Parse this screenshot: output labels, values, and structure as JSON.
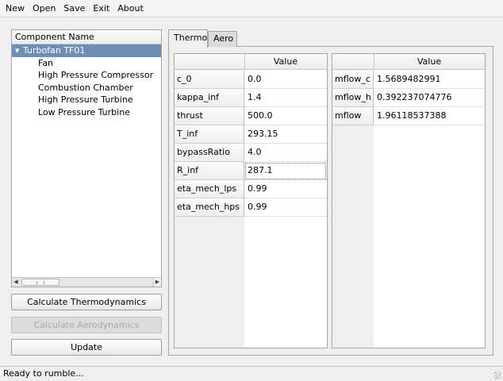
{
  "menu": [
    "New",
    "Open",
    "Save",
    "Exit",
    "About"
  ],
  "tree": {
    "header": "Component Name",
    "root": "Turbofan TF01",
    "children": [
      "Fan",
      "High Pressure Compressor",
      "Combustion Chamber",
      "High Pressure Turbine",
      "Low Pressure Turbine"
    ]
  },
  "buttons": {
    "calc_thermo": "Calculate Thermodynamics",
    "calc_aero": "Calculate Aerodynamics",
    "update": "Update"
  },
  "tabs": [
    "Thermo",
    "Aero"
  ],
  "inputs_table": {
    "value_header": "Value",
    "rows": [
      {
        "name": "c_0",
        "value": "0.0"
      },
      {
        "name": "kappa_inf",
        "value": "1.4"
      },
      {
        "name": "thrust",
        "value": "500.0"
      },
      {
        "name": "T_inf",
        "value": "293.15"
      },
      {
        "name": "bypassRatio",
        "value": "4.0"
      },
      {
        "name": "R_inf",
        "value": "287.1"
      },
      {
        "name": "eta_mech_lps",
        "value": "0.99"
      },
      {
        "name": "eta_mech_hps",
        "value": "0.99"
      }
    ]
  },
  "results_table": {
    "value_header": "Value",
    "rows": [
      {
        "name": "mflow_c",
        "value": "1.5689482991"
      },
      {
        "name": "mflow_h",
        "value": "0.392237074776"
      },
      {
        "name": "mflow",
        "value": "1.96118537388"
      }
    ]
  },
  "status": "Ready to rumble..."
}
